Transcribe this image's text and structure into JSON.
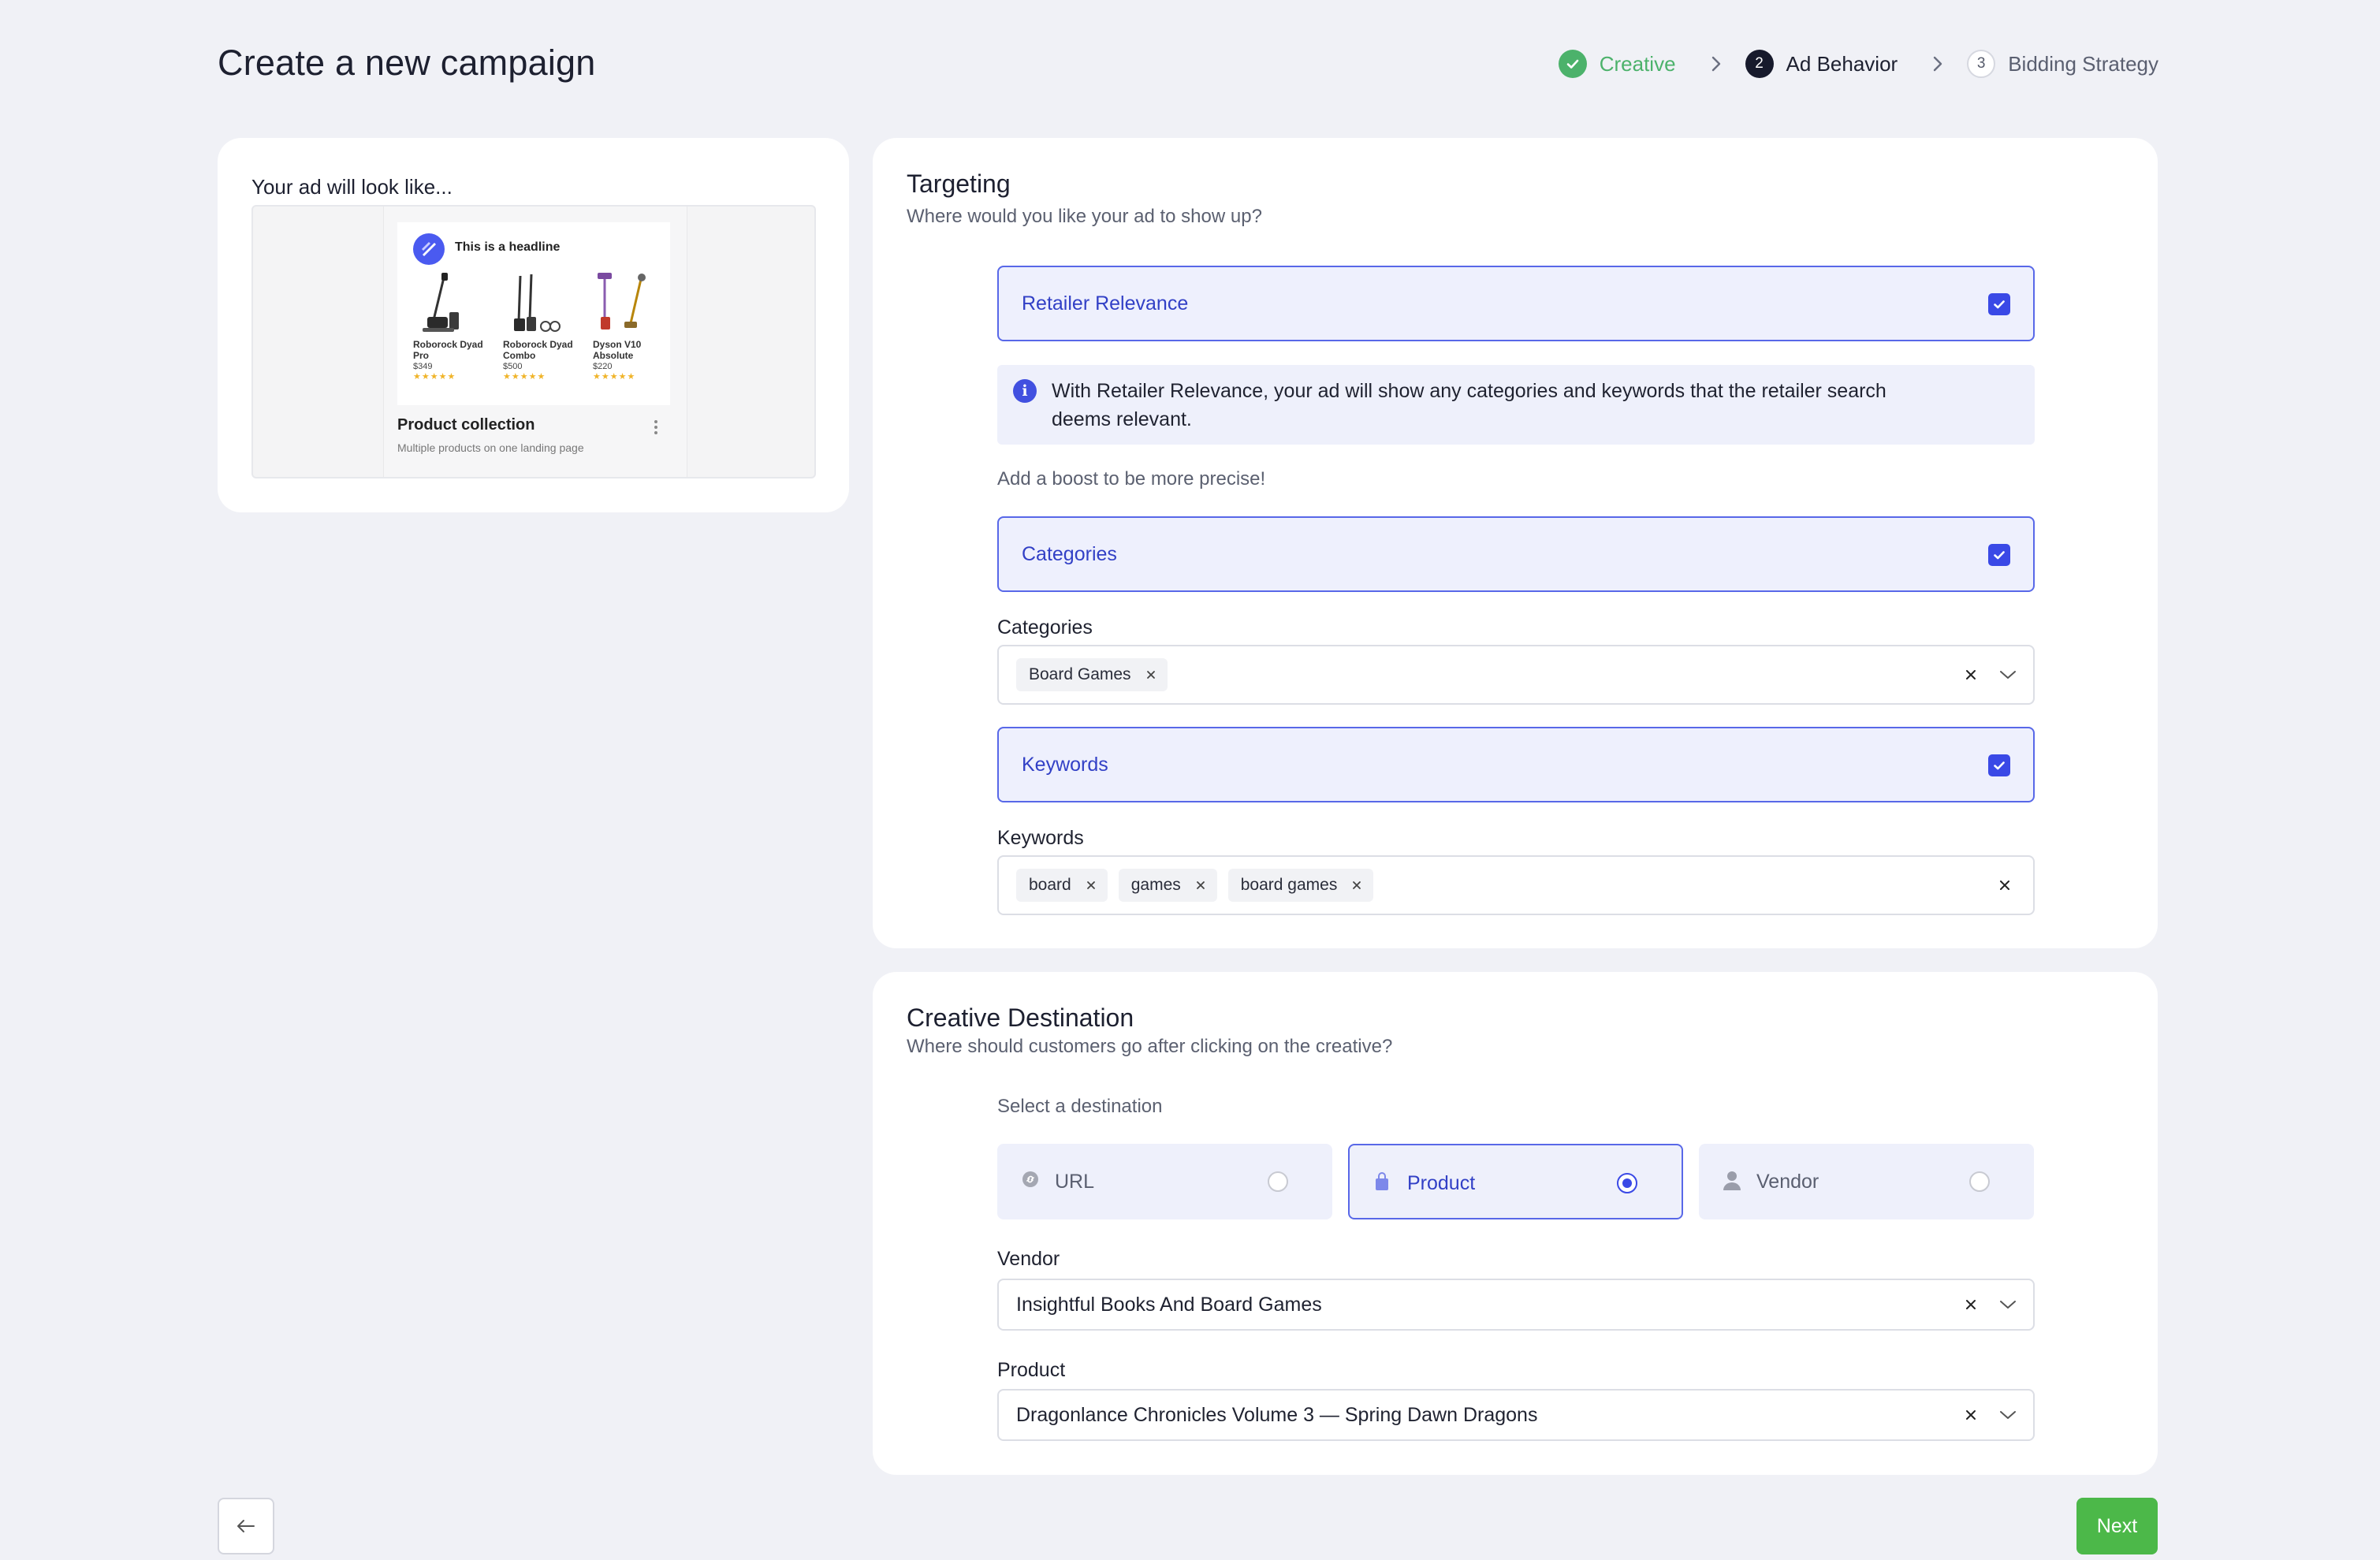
{
  "header": {
    "title": "Create a new campaign",
    "steps": [
      {
        "number": "",
        "label": "Creative",
        "state": "done"
      },
      {
        "number": "2",
        "label": "Ad Behavior",
        "state": "active"
      },
      {
        "number": "3",
        "label": "Bidding Strategy",
        "state": "todo"
      }
    ]
  },
  "preview": {
    "label": "Your ad will look like...",
    "ad_headline": "This is a headline",
    "products": [
      {
        "name": "Roborock Dyad Pro",
        "price": "$349",
        "stars": "★★★★★"
      },
      {
        "name": "Roborock Dyad Combo",
        "price": "$500",
        "stars": "★★★★★"
      },
      {
        "name": "Dyson V10 Absolute",
        "price": "$220",
        "stars": "★★★★★"
      }
    ],
    "ad_title": "Product collection",
    "ad_subtitle": "Multiple products on one landing page"
  },
  "targeting": {
    "title": "Targeting",
    "subtitle": "Where would you like your ad to show up?",
    "retailer_relevance": {
      "label": "Retailer Relevance",
      "checked": true
    },
    "info_text": "With Retailer Relevance, your ad will show any categories and keywords that the retailer search deems relevant.",
    "boost_text": "Add a boost to be more precise!",
    "categories_option": {
      "label": "Categories",
      "checked": true
    },
    "categories_field": {
      "label": "Categories",
      "chips": [
        "Board Games"
      ]
    },
    "keywords_option": {
      "label": "Keywords",
      "checked": true
    },
    "keywords_field": {
      "label": "Keywords",
      "chips": [
        "board",
        "games",
        "board games"
      ]
    }
  },
  "destination": {
    "title": "Creative Destination",
    "subtitle": "Where should customers go after clicking on the creative?",
    "select_label": "Select a destination",
    "options": [
      {
        "label": "URL",
        "icon": "link-icon",
        "selected": false
      },
      {
        "label": "Product",
        "icon": "shopping-bag-icon",
        "selected": true
      },
      {
        "label": "Vendor",
        "icon": "person-icon",
        "selected": false
      }
    ],
    "vendor_field": {
      "label": "Vendor",
      "value": "Insightful Books And Board Games"
    },
    "product_field": {
      "label": "Product",
      "value": "Dragonlance Chronicles Volume 3 — Spring Dawn Dragons"
    }
  },
  "footer": {
    "next_label": "Next"
  },
  "colors": {
    "accent": "#3a49e6",
    "success": "#4cb26b",
    "next_button": "#4cb849",
    "background": "#f0f1f6"
  }
}
